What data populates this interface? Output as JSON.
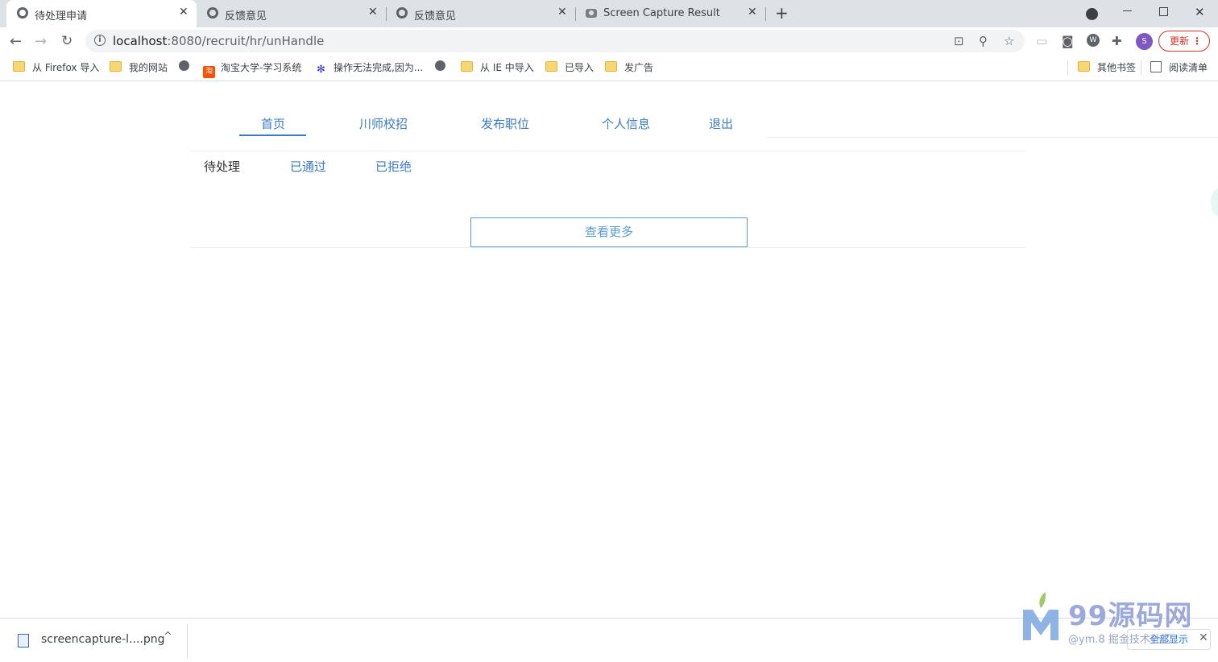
{
  "browser": {
    "tabs": [
      {
        "title": "待处理申请",
        "icon": "globe-icon",
        "active": true
      },
      {
        "title": "反馈意见",
        "icon": "globe-icon",
        "active": false
      },
      {
        "title": "反馈意见",
        "icon": "globe-icon",
        "active": false
      },
      {
        "title": "Screen Capture Result",
        "icon": "camera-icon",
        "active": false
      }
    ],
    "new_tab": "+",
    "close": "✕",
    "url_host": "localhost",
    "url_path": ":8080/recruit/hr/unHandle",
    "profile_initial": "S",
    "update_label": "更新",
    "bookmarks": [
      "从 Firefox 导入",
      "我的网站",
      "淘宝大学-学习系统",
      "操作无法完成,因为...",
      "从 IE 中导入",
      "已导入",
      "发广告"
    ],
    "bookmarks_right": [
      "其他书签",
      "阅读清单"
    ],
    "taobao_glyph": "淘"
  },
  "page": {
    "nav": [
      "首页",
      "川师校招",
      "发布职位",
      "个人信息",
      "退出"
    ],
    "subtabs": [
      "待处理",
      "已通过",
      "已拒绝"
    ],
    "more_button": "查看更多"
  },
  "downloads": {
    "file_name": "screencapture-l....png",
    "show_all": "全部显示"
  },
  "watermark": {
    "title": "99源码网",
    "subtitle": "@ym.8 掘金技术社区"
  },
  "colors": {
    "accent": "#3a7bc8",
    "more_border": "#5b9bd5",
    "update_red": "#d93025",
    "profile": "#7e57c2"
  }
}
